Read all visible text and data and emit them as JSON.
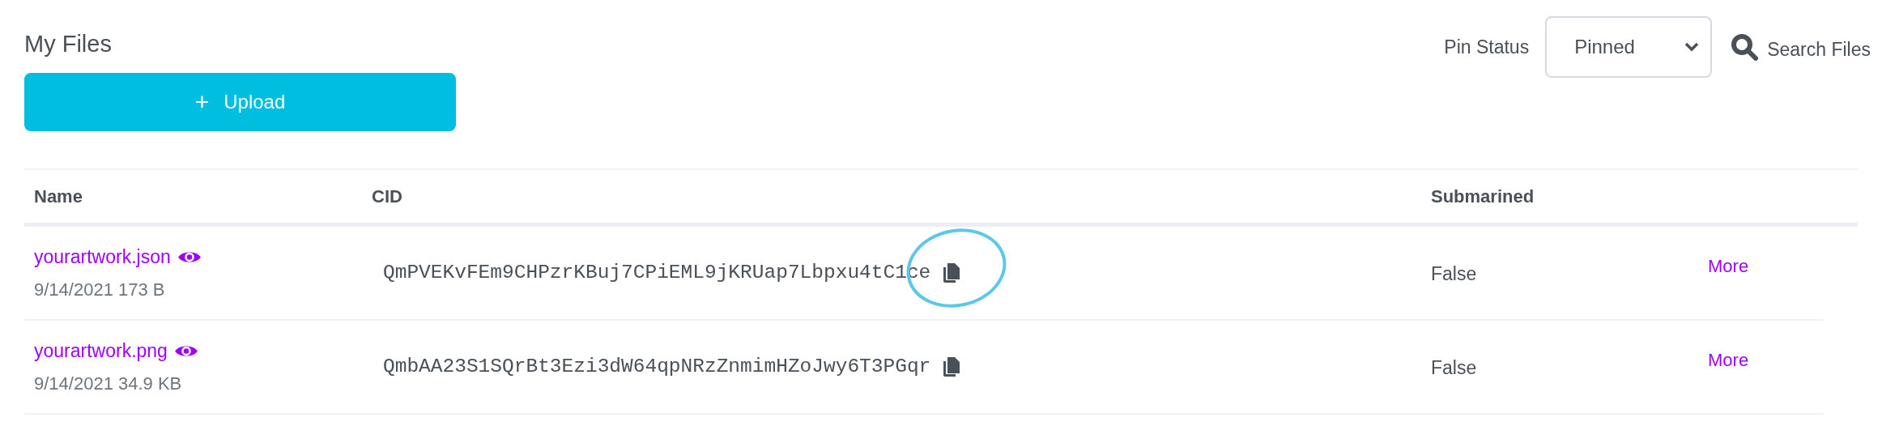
{
  "title": "My Files",
  "upload_button": {
    "icon": "+",
    "label": "Upload"
  },
  "pin_status": {
    "label": "Pin Status",
    "value": "Pinned"
  },
  "search": {
    "label": "Search Files"
  },
  "table": {
    "columns": [
      "Name",
      "CID",
      "Submarined"
    ],
    "rows": [
      {
        "name": "yourartwork.json",
        "meta": "9/14/2021 173 B",
        "cid": "QmPVEKvFEm9CHPzrKBuj7CPiEML9jKRUap7Lbpxu4tC1ce",
        "highlighted": true,
        "submarined": "False",
        "action": "More"
      },
      {
        "name": "yourartwork.png",
        "meta": "9/14/2021 34.9 KB",
        "cid": "QmbAA23S1SQrBt3Ezi3dW64qpNRzZnmimHZoJwy6T3PGqr",
        "highlighted": false,
        "submarined": "False",
        "action": "More"
      }
    ]
  }
}
